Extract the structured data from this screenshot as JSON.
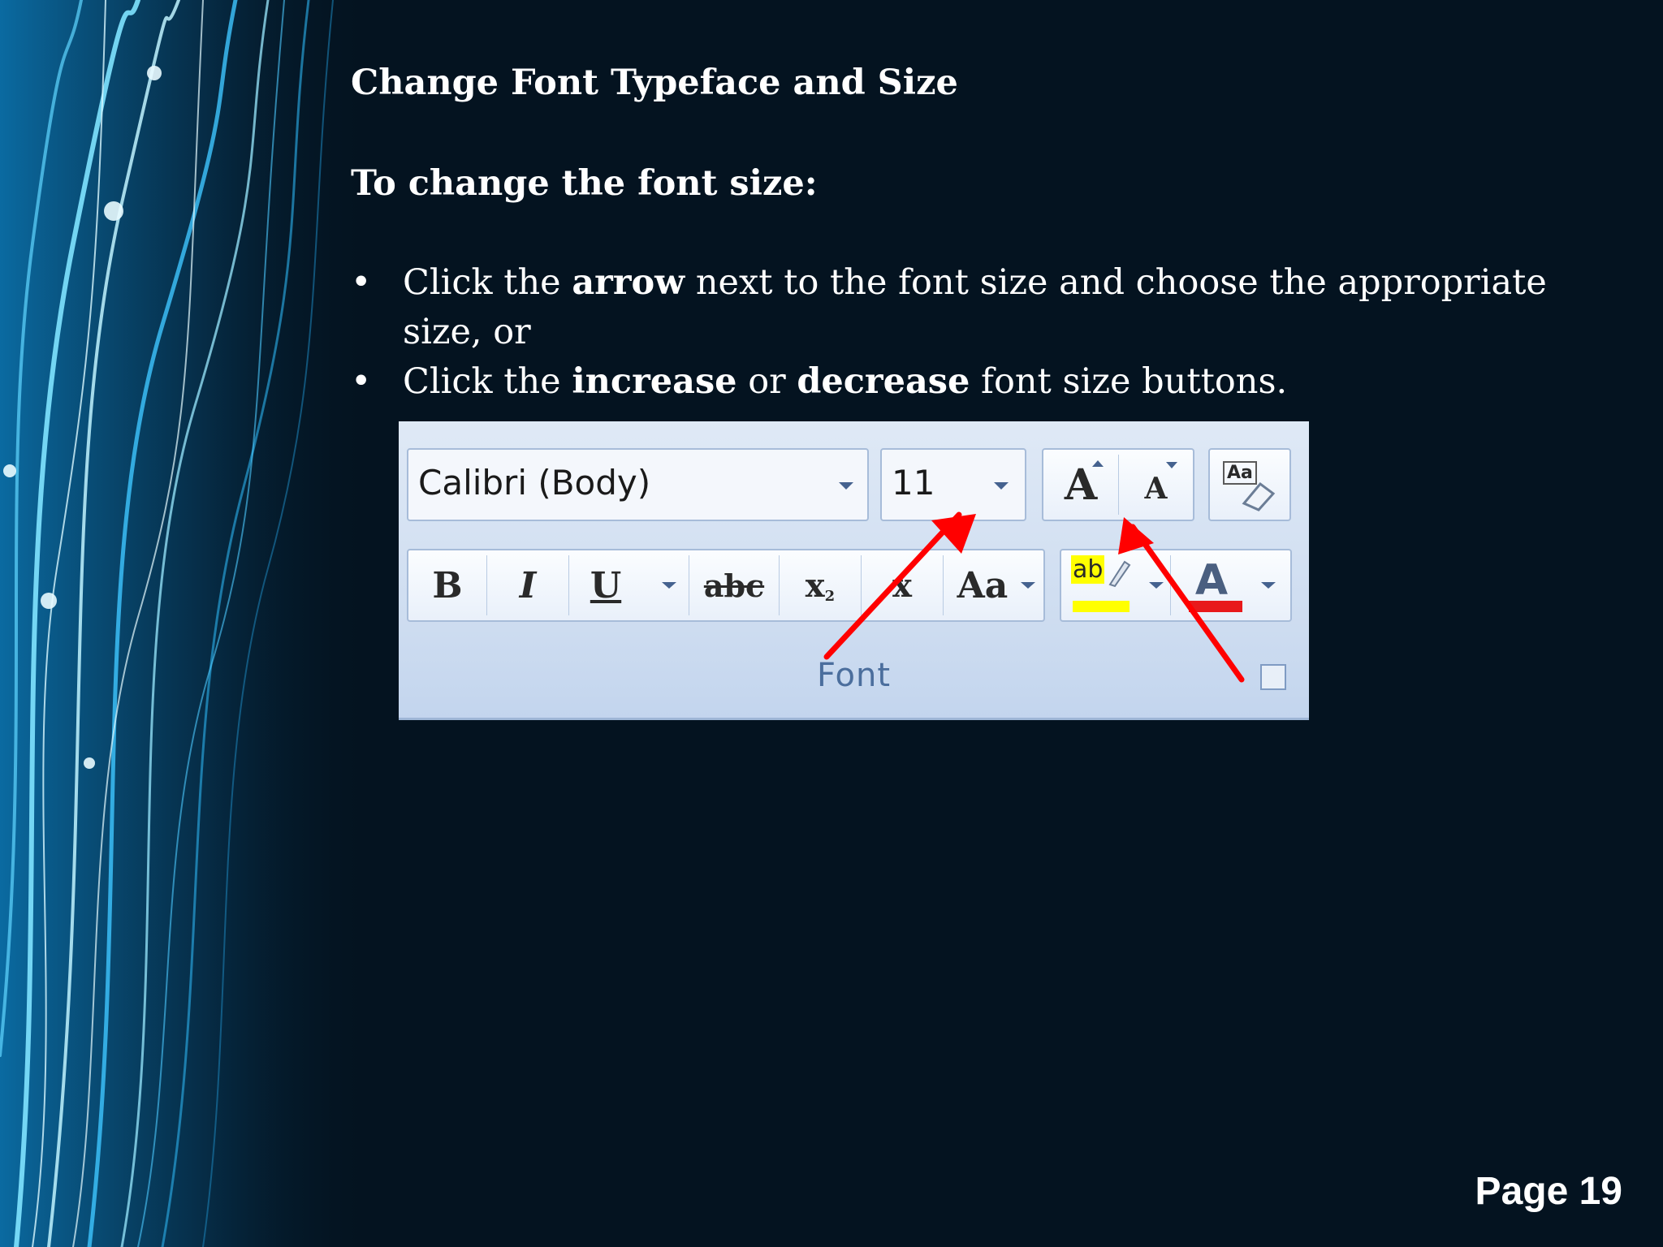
{
  "slide": {
    "title": "Change Font Typeface and Size",
    "subtitle": "To change the font size:",
    "bullets": [
      {
        "pre": "Click the ",
        "b1": "arrow",
        "post": " next to the font size and choose the appropriate size, or"
      },
      {
        "pre": "Click the ",
        "b1": "increase",
        "mid": " or ",
        "b2": "decrease",
        "post": " font size buttons."
      }
    ],
    "bullet_symbol": "•"
  },
  "ribbon": {
    "font_name": "Calibri (Body)",
    "font_size": "11",
    "grow_label": "A",
    "shrink_label": "A",
    "clear_format_label": "Aa",
    "bold_label": "B",
    "italic_label": "I",
    "underline_label": "U",
    "strike_label": "abc",
    "subscript_label": "x",
    "subscript_mark": "2",
    "superscript_label": "x",
    "change_case_label": "Aa",
    "highlight_label": "ab",
    "font_color_label": "A",
    "group_label": "Font",
    "annotation_color": "#ff0000",
    "highlight_color": "#ffff00",
    "font_color": "#e8191b"
  },
  "footer": {
    "page_label": "Page 19"
  }
}
